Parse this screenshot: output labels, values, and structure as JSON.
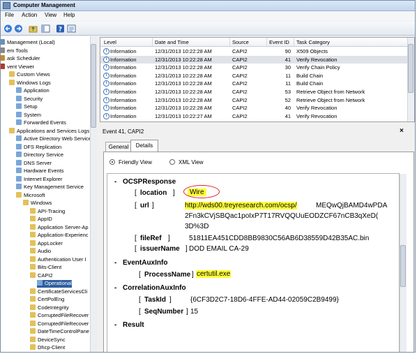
{
  "window": {
    "title": "Computer Management"
  },
  "menu": [
    "File",
    "Action",
    "View",
    "Help"
  ],
  "toolbar": {
    "icons": [
      "back-arrow-icon",
      "forward-arrow-icon",
      "up-folder-icon",
      "show-hide-tree-icon",
      "help-icon",
      "properties-icon"
    ]
  },
  "tree": {
    "items": [
      {
        "label": "Management (Local)",
        "depth": 0,
        "icon": "computer-icon"
      },
      {
        "label": "em Tools",
        "depth": 0,
        "icon": "tools-icon"
      },
      {
        "label": "ask Scheduler",
        "depth": 0,
        "icon": "scheduler-icon"
      },
      {
        "label": "vent Viewer",
        "depth": 0,
        "icon": "event-viewer-icon"
      },
      {
        "label": "Custom Views",
        "depth": 1,
        "icon": "folder-icon"
      },
      {
        "label": "Windows Logs",
        "depth": 1,
        "icon": "folder-icon"
      },
      {
        "label": "Application",
        "depth": 2,
        "icon": "log-icon"
      },
      {
        "label": "Security",
        "depth": 2,
        "icon": "log-icon"
      },
      {
        "label": "Setup",
        "depth": 2,
        "icon": "log-icon"
      },
      {
        "label": "System",
        "depth": 2,
        "icon": "log-icon"
      },
      {
        "label": "Forwarded Events",
        "depth": 2,
        "icon": "log-icon"
      },
      {
        "label": "Applications and Services Logs",
        "depth": 1,
        "icon": "folder-icon"
      },
      {
        "label": "Active Directory Web Services",
        "depth": 2,
        "icon": "log-icon"
      },
      {
        "label": "DFS Replication",
        "depth": 2,
        "icon": "log-icon"
      },
      {
        "label": "Directory Service",
        "depth": 2,
        "icon": "log-icon"
      },
      {
        "label": "DNS Server",
        "depth": 2,
        "icon": "log-icon"
      },
      {
        "label": "Hardware Events",
        "depth": 2,
        "icon": "log-icon"
      },
      {
        "label": "Internet Explorer",
        "depth": 2,
        "icon": "log-icon"
      },
      {
        "label": "Key Management Service",
        "depth": 2,
        "icon": "log-icon"
      },
      {
        "label": "Microsoft",
        "depth": 2,
        "icon": "folder-icon"
      },
      {
        "label": "Windows",
        "depth": 3,
        "icon": "folder-icon"
      },
      {
        "label": "API-Tracing",
        "depth": 4,
        "icon": "folder-icon"
      },
      {
        "label": "AppID",
        "depth": 4,
        "icon": "folder-icon"
      },
      {
        "label": "Application Server-Ap",
        "depth": 4,
        "icon": "folder-icon"
      },
      {
        "label": "Application-Experienc",
        "depth": 4,
        "icon": "folder-icon"
      },
      {
        "label": "AppLocker",
        "depth": 4,
        "icon": "folder-icon"
      },
      {
        "label": "Audio",
        "depth": 4,
        "icon": "folder-icon"
      },
      {
        "label": "Authentication User I",
        "depth": 4,
        "icon": "folder-icon"
      },
      {
        "label": "Bits-Client",
        "depth": 4,
        "icon": "folder-icon"
      },
      {
        "label": "CAPI2",
        "depth": 4,
        "icon": "folder-icon"
      },
      {
        "label": "Operational",
        "depth": 5,
        "icon": "log-icon",
        "selected": true
      },
      {
        "label": "CertificateServicesCli",
        "depth": 4,
        "icon": "folder-icon"
      },
      {
        "label": "CertPolEng",
        "depth": 4,
        "icon": "folder-icon"
      },
      {
        "label": "CodeIntegrity",
        "depth": 4,
        "icon": "folder-icon"
      },
      {
        "label": "CorruptedFileRecover",
        "depth": 4,
        "icon": "folder-icon"
      },
      {
        "label": "CorruptedFileRecover",
        "depth": 4,
        "icon": "folder-icon"
      },
      {
        "label": "DateTimeControlPane",
        "depth": 4,
        "icon": "folder-icon"
      },
      {
        "label": "DeviceSync",
        "depth": 4,
        "icon": "folder-icon"
      },
      {
        "label": "Dhcp-Client",
        "depth": 4,
        "icon": "folder-icon"
      }
    ]
  },
  "list": {
    "columns": [
      "Level",
      "Date and Time",
      "Source",
      "Event ID",
      "Task Category"
    ],
    "rows": [
      {
        "level": "Information",
        "datetime": "12/31/2013 10:22:28 AM",
        "source": "CAPI2",
        "event_id": "90",
        "category": "X509 Objects"
      },
      {
        "level": "Information",
        "datetime": "12/31/2013 10:22:28 AM",
        "source": "CAPI2",
        "event_id": "41",
        "category": "Verify Revocation",
        "selected": true
      },
      {
        "level": "Information",
        "datetime": "12/31/2013 10:22:28 AM",
        "source": "CAPI2",
        "event_id": "30",
        "category": "Verify Chain Policy"
      },
      {
        "level": "Information",
        "datetime": "12/31/2013 10:22:28 AM",
        "source": "CAPI2",
        "event_id": "11",
        "category": "Build Chain"
      },
      {
        "level": "Information",
        "datetime": "12/31/2013 10:22:28 AM",
        "source": "CAPI2",
        "event_id": "11",
        "category": "Build Chain"
      },
      {
        "level": "Information",
        "datetime": "12/31/2013 10:22:28 AM",
        "source": "CAPI2",
        "event_id": "53",
        "category": "Retrieve Object from Network"
      },
      {
        "level": "Information",
        "datetime": "12/31/2013 10:22:28 AM",
        "source": "CAPI2",
        "event_id": "52",
        "category": "Retrieve Object from Network"
      },
      {
        "level": "Information",
        "datetime": "12/31/2013 10:22:28 AM",
        "source": "CAPI2",
        "event_id": "40",
        "category": "Verify Revocation"
      },
      {
        "level": "Information",
        "datetime": "12/31/2013 10:22:27 AM",
        "source": "CAPI2",
        "event_id": "41",
        "category": "Verify Revocation"
      }
    ]
  },
  "details": {
    "title": "Event 41, CAPI2",
    "close": "×",
    "tabs": {
      "general": "General",
      "details": "Details"
    },
    "views": {
      "friendly": "Friendly View",
      "xml": "XML View"
    },
    "xml": {
      "ocsp_header": "OCSPResponse",
      "location_key": "location",
      "location_val": "Wire",
      "url_key": "url",
      "url_val_hl": "http://wds00.treyresearch.com/ocsp/",
      "url_val_rest": "MEQwQjBAMD4wPDA",
      "url_line2": "2Fn3kCVjSBQac1poIxP7T17RVQQUuEODZCF67nCB3qXeD(",
      "url_line3": "3D%3D",
      "fileref_key": "fileRef",
      "fileref_val": "51811EA451CDD8BB9830C56AB6D38559D42B35AC.bin",
      "issuer_key": "issuerName",
      "issuer_val": "DOD EMAIL CA-29",
      "aux_header": "EventAuxInfo",
      "proc_key": "ProcessName",
      "proc_val": "certutil.exe",
      "corr_header": "CorrelationAuxInfo",
      "task_key": "TaskId",
      "task_val": "{6CF3D2C7-18D6-4FFE-AD44-02059C2B9499}",
      "seq_key": "SeqNumber",
      "seq_val": "15",
      "result_header": "Result",
      "lbr": "[",
      "rbr": "]",
      "minus": "-"
    }
  }
}
